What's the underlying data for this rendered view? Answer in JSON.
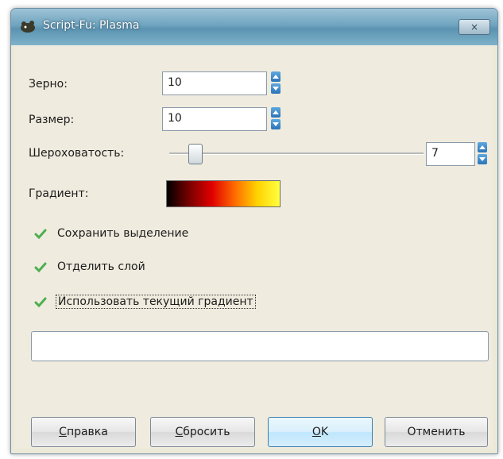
{
  "window": {
    "title": "Script-Fu: Plasma",
    "close_label": "×"
  },
  "fields": {
    "grain": {
      "label": "Зерно:",
      "value": "10"
    },
    "size": {
      "label": "Размер:",
      "value": "10"
    },
    "roughness": {
      "label": "Шероховатость:",
      "value": "7",
      "slider_fraction": 0.1
    },
    "gradient": {
      "label": "Градиент:",
      "colors": [
        "#000000",
        "#7a0000",
        "#e00000",
        "#ff6a00",
        "#ffd200",
        "#ffff40"
      ]
    }
  },
  "checkboxes": [
    {
      "label": "Сохранить выделение",
      "checked": true
    },
    {
      "label": "Отделить слой",
      "checked": true
    },
    {
      "label": "Использовать текущий градиент",
      "checked": true
    }
  ],
  "progress_text": "",
  "buttons": {
    "help": {
      "underline": "С",
      "rest": "правка"
    },
    "reset": {
      "underline": "С",
      "rest": "бросить"
    },
    "ok": {
      "underline": "O",
      "rest": "K"
    },
    "cancel": {
      "underline": "",
      "rest": "Отменить"
    }
  },
  "accent_color": "#4caf50"
}
